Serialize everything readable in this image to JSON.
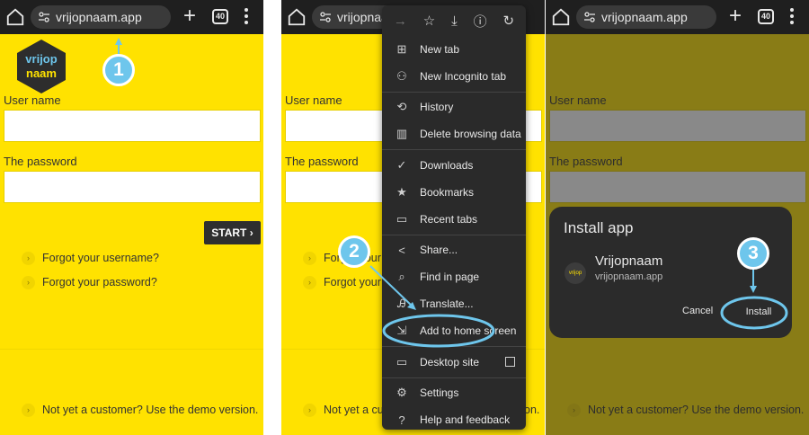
{
  "browser": {
    "url": "vrijopnaam.app",
    "tab_count": "40"
  },
  "login": {
    "logo_line1": "vrijop",
    "logo_line2": "naam",
    "username_label": "User name",
    "password_label": "The password",
    "start_button": "START",
    "forgot_username": "Forgot your username?",
    "forgot_password": "Forgot your password?",
    "demo_link": "Not yet a customer? Use the demo version."
  },
  "steps": {
    "one": "1",
    "two": "2",
    "three": "3"
  },
  "menu": {
    "items": [
      {
        "label": "New tab",
        "icon": "plus-square-icon"
      },
      {
        "label": "New Incognito tab",
        "icon": "incognito-icon"
      },
      {
        "label": "History",
        "icon": "history-icon"
      },
      {
        "label": "Delete browsing data",
        "icon": "trash-icon"
      },
      {
        "label": "Downloads",
        "icon": "download-check-icon"
      },
      {
        "label": "Bookmarks",
        "icon": "star-icon"
      },
      {
        "label": "Recent tabs",
        "icon": "devices-icon"
      },
      {
        "label": "Share...",
        "icon": "share-icon"
      },
      {
        "label": "Find in page",
        "icon": "find-icon"
      },
      {
        "label": "Translate...",
        "icon": "translate-icon"
      },
      {
        "label": "Add to home screen",
        "icon": "add-home-icon"
      },
      {
        "label": "Desktop site",
        "icon": "desktop-icon"
      },
      {
        "label": "Settings",
        "icon": "gear-icon"
      },
      {
        "label": "Help and feedback",
        "icon": "help-icon"
      }
    ]
  },
  "install_dialog": {
    "title": "Install app",
    "app_name": "Vrijopnaam",
    "app_url": "vrijopnaam.app",
    "cancel": "Cancel",
    "install": "Install"
  },
  "colors": {
    "page_yellow": "#ffe200",
    "toolbar": "#1f1f1f",
    "menu_bg": "#2a2a2a",
    "highlight": "#6ec6ec"
  }
}
